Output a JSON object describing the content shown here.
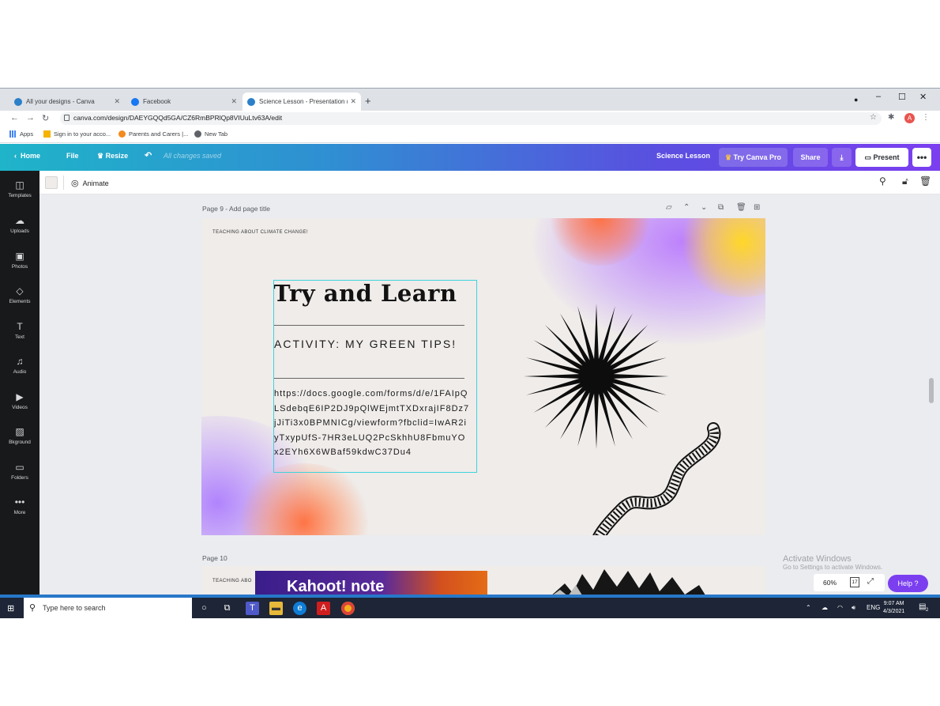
{
  "browser": {
    "tabs": [
      {
        "label": "All your designs - Canva",
        "favicon_color": "#2c7fc9"
      },
      {
        "label": "Facebook",
        "favicon_color": "#1877f2"
      },
      {
        "label": "Science Lesson - Presentation (16:9)",
        "favicon_color": "#2c7fc9"
      }
    ],
    "new_tab_symbol": "+",
    "url": "canva.com/design/DAEYGQQd5GA/CZ6RmBPRlQp8VIUuLtv63A/edit",
    "avatar_letter": "A",
    "bookmarks": [
      "Apps",
      "Sign in to your acco...",
      "Parents and Carers |...",
      "New Tab"
    ]
  },
  "canva": {
    "home_label": "Home",
    "file_label": "File",
    "resize_label": "Resize",
    "save_status": "All changes saved",
    "design_title": "Science Lesson",
    "try_pro_label": "Try Canva Pro",
    "share_label": "Share",
    "present_label": "Present",
    "more_label": "•••",
    "animate_label": "Animate",
    "sidebar": [
      {
        "label": "Templates",
        "icon": "templates-icon",
        "glyph": "◫"
      },
      {
        "label": "Uploads",
        "icon": "uploads-icon",
        "glyph": "☁"
      },
      {
        "label": "Photos",
        "icon": "photos-icon",
        "glyph": "▣"
      },
      {
        "label": "Elements",
        "icon": "elements-icon",
        "glyph": "◇"
      },
      {
        "label": "Text",
        "icon": "text-icon",
        "glyph": "T"
      },
      {
        "label": "Audio",
        "icon": "audio-icon",
        "glyph": "♫"
      },
      {
        "label": "Videos",
        "icon": "videos-icon",
        "glyph": "▶"
      },
      {
        "label": "Bkground",
        "icon": "background-icon",
        "glyph": "▨"
      },
      {
        "label": "Folders",
        "icon": "folders-icon",
        "glyph": "▭"
      },
      {
        "label": "More",
        "icon": "more-icon",
        "glyph": "•••"
      }
    ],
    "page9_header": "Page 9 - Add page title",
    "page10_header": "Page 10",
    "zoom": "60%",
    "page_count": "17",
    "help_label": "Help ?"
  },
  "slide": {
    "kicker": "TEACHING ABOUT CLIMATE CHANGE!",
    "title": "Try and Learn",
    "activity": "ACTIVITY: MY GREEN TIPS!",
    "link": "https://docs.google.com/forms/d/e/1FAIpQLSdebqE6IP2DJ9pQlWEjmtTXDxrajIF8Dz7jJiTi3x0BPMNICg/viewform?fbclid=IwAR2iyTxypUfS-7HR3eLUQ2PcSkhhU8FbmuYOx2EYh6X6WBaf59kdwC37Du4"
  },
  "slide2": {
    "kicker": "TEACHING ABO",
    "image_text": "Kahoot! note"
  },
  "windows": {
    "activate_title": "Activate Windows",
    "activate_sub": "Go to Settings to activate Windows.",
    "search_placeholder": "Type here to search",
    "language": "ENG",
    "time": "9:07 AM",
    "date": "4/3/2021",
    "notification_count": "2"
  },
  "colors": {
    "canva_gradient_start": "#1fb4c9",
    "canva_gradient_end": "#7b3ff0",
    "selection": "#3fd3dc",
    "sidebar_bg": "#18191b",
    "slide_bg": "#efecea"
  }
}
